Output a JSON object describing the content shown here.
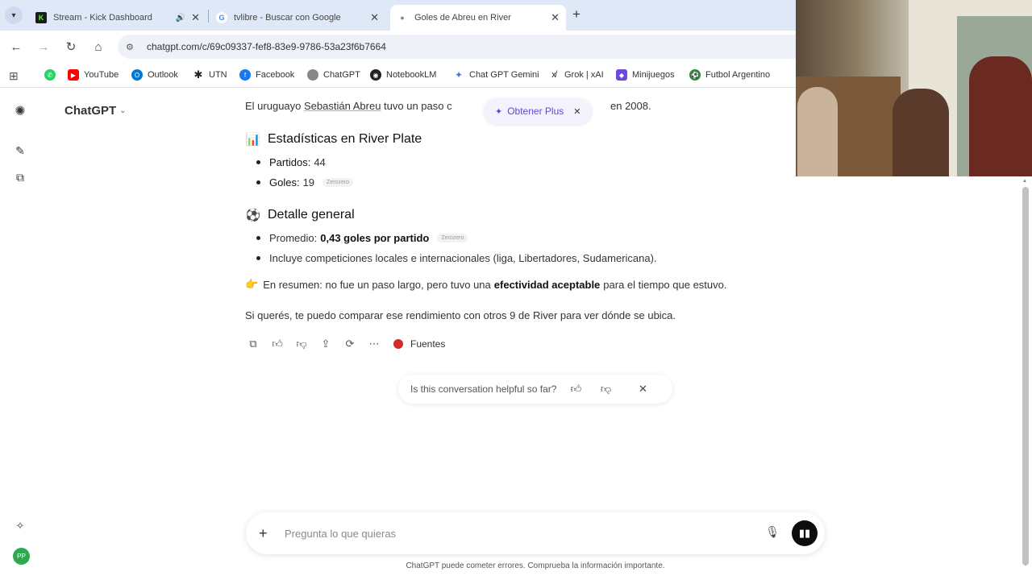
{
  "browser": {
    "tabs": [
      {
        "title": "Stream - Kick Dashboard",
        "favicon": "K",
        "favicon_color": "#53fc18",
        "audio": true
      },
      {
        "title": "tvlibre - Buscar con Google",
        "favicon": "G",
        "favicon_color": "#4285f4"
      },
      {
        "title": "Goles de Abreu en River",
        "favicon": "●",
        "favicon_color": "#888888",
        "active": true
      }
    ],
    "tab_list_icon": "chevron-down-icon",
    "new_tab_icon": "plus-icon",
    "url": "chatgpt.com/c/69c09337-fef8-83e9-9786-53a23f6b7664",
    "bookmarks": [
      {
        "label": "",
        "icon_color": "#25d366",
        "icon": "whatsapp-icon"
      },
      {
        "label": "YouTube",
        "icon_color": "#ff0000"
      },
      {
        "label": "Outlook",
        "icon_color": "#0078d4"
      },
      {
        "label": "UTN",
        "icon_color": "#222222"
      },
      {
        "label": "Facebook",
        "icon_color": "#1877f2"
      },
      {
        "label": "ChatGPT",
        "icon_color": "#888888"
      },
      {
        "label": "NotebookLM",
        "icon_color": "#222222"
      },
      {
        "label": "Chat GPT Gemini",
        "icon_color": "#4b7bd9"
      },
      {
        "label": "Grok | xAI",
        "icon_color": "#222222"
      },
      {
        "label": "Minijuegos",
        "icon_color": "#6d4ad9"
      },
      {
        "label": "Futbol Argentino",
        "icon_color": "#2a8a3a"
      }
    ]
  },
  "sidebar": {
    "brand": "ChatGPT",
    "avatar_initials": "PP"
  },
  "upsell": {
    "label": "Obtener Plus"
  },
  "message": {
    "intro_before": "El uruguayo",
    "intro_name": "Sebastián Abreu",
    "intro_after": "tuvo un paso c",
    "intro_tail": "en 2008.",
    "section1": {
      "heading": "Estadísticas en River Plate",
      "items": [
        {
          "label": "Partidos:",
          "value": "44",
          "chip": ""
        },
        {
          "label": "Goles:",
          "value": "19",
          "chip": "Zerozero"
        }
      ]
    },
    "section2": {
      "heading": "Detalle general",
      "items": [
        {
          "label": "Promedio:",
          "value": "0,43 goles por partido",
          "chip": "Zerozero"
        },
        {
          "text": "Incluye competiciones locales e internacionales (liga, Libertadores, Sudamericana)."
        }
      ]
    },
    "summary_before": "En resumen: no fue un paso largo, pero tuvo una",
    "summary_bold": "efectividad aceptable",
    "summary_after": "para el tiempo que estuvo.",
    "closing": "Si querés, te puedo comparar ese rendimiento con otros 9 de River para ver dónde se ubica.",
    "sources_label": "Fuentes"
  },
  "feedback": {
    "question": "Is this conversation helpful so far?"
  },
  "composer": {
    "placeholder": "Pregunta lo que quieras"
  },
  "disclaimer": "ChatGPT puede cometer errores. Comprueba la información importante."
}
